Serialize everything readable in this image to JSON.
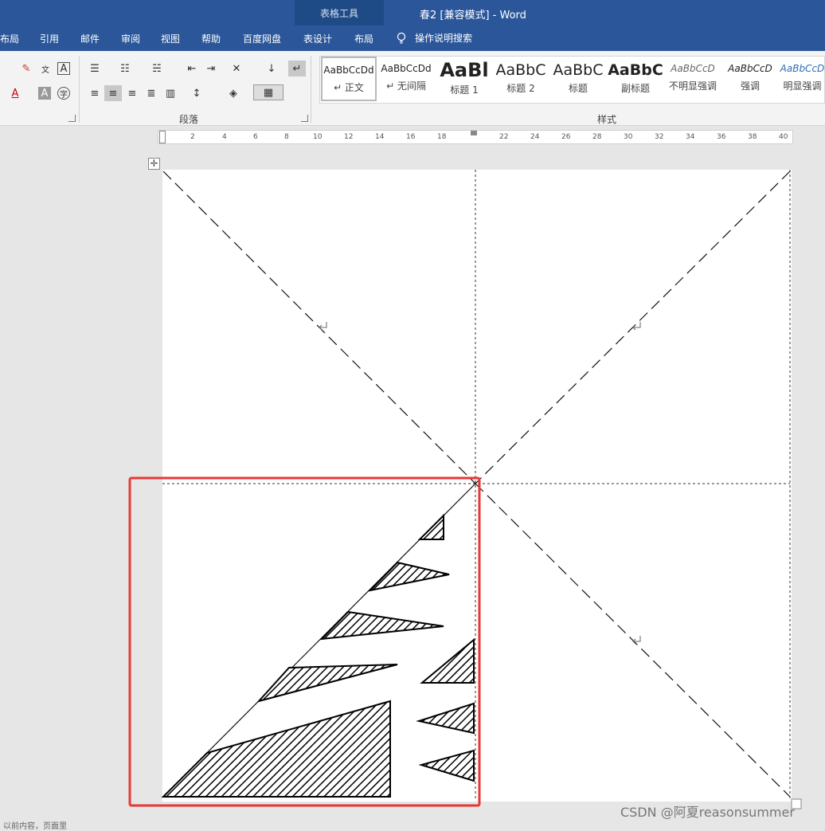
{
  "titlebar": {
    "context_tools": "表格工具",
    "document_title": "春2 [兼容模式]  -  Word"
  },
  "tabs": [
    {
      "label": "布局"
    },
    {
      "label": "引用"
    },
    {
      "label": "邮件"
    },
    {
      "label": "审阅"
    },
    {
      "label": "视图"
    },
    {
      "label": "帮助"
    },
    {
      "label": "百度网盘"
    },
    {
      "label": "表设计"
    },
    {
      "label": "布局"
    }
  ],
  "tell_me": {
    "label": "操作说明搜索"
  },
  "ribbon": {
    "groups": {
      "paragraph": "段落",
      "styles": "样式"
    },
    "styles": [
      {
        "sample": "AaBbCcDd",
        "name": "↵ 正文"
      },
      {
        "sample": "AaBbCcDd",
        "name": "↵ 无间隔"
      },
      {
        "sample": "AaBl",
        "name": "标题 1"
      },
      {
        "sample": "AaBbC",
        "name": "标题 2"
      },
      {
        "sample": "AaBbC",
        "name": "标题"
      },
      {
        "sample": "AaBbC",
        "name": "副标题"
      },
      {
        "sample": "AaBbCcD",
        "name": "不明显强调"
      },
      {
        "sample": "AaBbCcD",
        "name": "强调"
      },
      {
        "sample": "AaBbCcD",
        "name": "明显强调"
      }
    ]
  },
  "ruler": {
    "numbers": [
      "2",
      "4",
      "6",
      "8",
      "10",
      "12",
      "14",
      "16",
      "18",
      "22",
      "24",
      "26",
      "28",
      "30",
      "32",
      "34",
      "36",
      "38",
      "40"
    ]
  },
  "watermark": "CSDN @阿夏reasonsummer",
  "status": "以前内容，页面里",
  "colors": {
    "title_bar": "#2b579a",
    "highlight_box": "#e53935"
  }
}
